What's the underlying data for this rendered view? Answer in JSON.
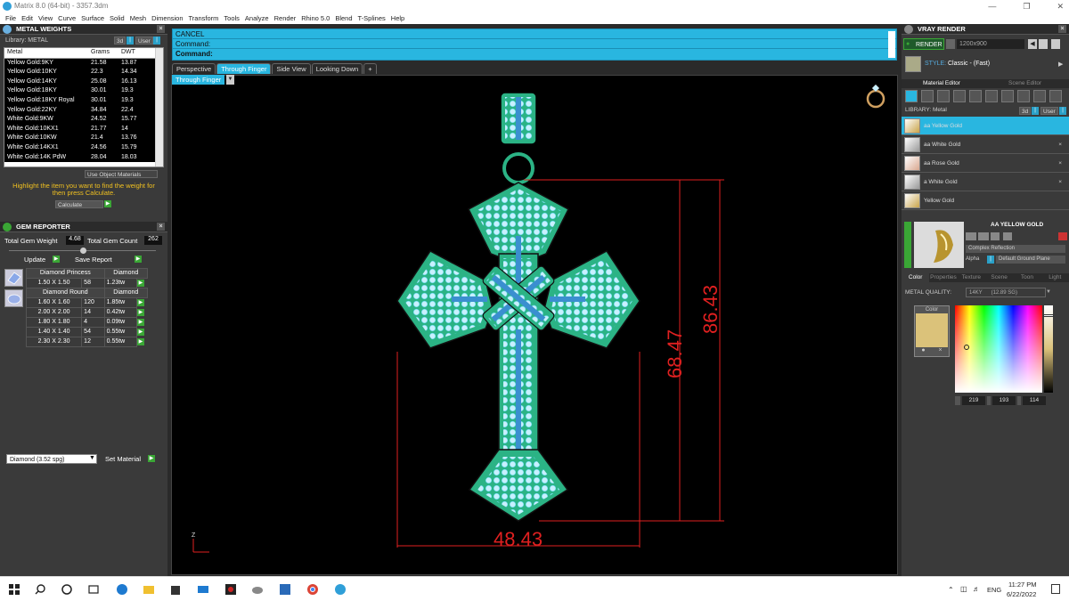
{
  "window": {
    "title": "Matrix 8.0 (64-bit) - 3357.3dm"
  },
  "menu": [
    "File",
    "Edit",
    "View",
    "Curve",
    "Surface",
    "Solid",
    "Mesh",
    "Dimension",
    "Transform",
    "Tools",
    "Analyze",
    "Render",
    "Rhino 5.0",
    "Blend",
    "T-Splines",
    "Help"
  ],
  "metal_weights": {
    "title": "METAL WEIGHTS",
    "library_label": "Library: METAL",
    "lib_btn_3d": "3d",
    "lib_btn_user": "User",
    "columns": [
      "Metal",
      "Grams",
      "DWT"
    ],
    "rows": [
      [
        "Yellow Gold:9KY",
        "21.58",
        "13.87"
      ],
      [
        "Yellow Gold:10KY",
        "22.3",
        "14.34"
      ],
      [
        "Yellow Gold:14KY",
        "25.08",
        "16.13"
      ],
      [
        "Yellow Gold:18KY",
        "30.01",
        "19.3"
      ],
      [
        "Yellow Gold:18KY Royal",
        "30.01",
        "19.3"
      ],
      [
        "Yellow Gold:22KY",
        "34.84",
        "22.4"
      ],
      [
        "White Gold:9KW",
        "24.52",
        "15.77"
      ],
      [
        "White Gold:10KX1",
        "21.77",
        "14"
      ],
      [
        "White Gold:10KW",
        "21.4",
        "13.76"
      ],
      [
        "White Gold:14KX1",
        "24.56",
        "15.79"
      ],
      [
        "White Gold:14K PdW",
        "28.04",
        "18.03"
      ]
    ],
    "use_object_materials": "Use Object Materials",
    "hint": "Highlight the item you want to find the weight for then press Calculate.",
    "calculate": "Calculate"
  },
  "gem_reporter": {
    "title": "GEM REPORTER",
    "total_weight_label": "Total Gem Weight",
    "total_weight": "4.68",
    "total_count_label": "Total Gem Count",
    "total_count": "262",
    "update": "Update",
    "save_report": "Save Report",
    "groups": [
      {
        "shape": "Diamond Princess",
        "material": "Diamond",
        "rows": [
          [
            "1.50 X 1.50",
            "58",
            "1.23tw"
          ]
        ]
      },
      {
        "shape": "Diamond Round",
        "material": "Diamond",
        "rows": [
          [
            "1.60 X 1.60",
            "120",
            "1.85tw"
          ],
          [
            "2.00 X 2.00",
            "14",
            "0.42tw"
          ],
          [
            "1.80 X 1.80",
            "4",
            "0.09tw"
          ],
          [
            "1.40 X 1.40",
            "54",
            "0.55tw"
          ],
          [
            "2.30 X 2.30",
            "12",
            "0.55tw"
          ]
        ]
      }
    ],
    "material_select": "Diamond     (3.52 spg)",
    "set_material": "Set Material"
  },
  "command": {
    "line1": "CANCEL",
    "line2": "Command:",
    "line3": "Command:"
  },
  "view_tabs": [
    "Perspective",
    "Through Finger",
    "Side View",
    "Looking Down",
    "+"
  ],
  "active_tab_index": 1,
  "viewport_label": "Through Finger",
  "dimensions": {
    "width": "48.43",
    "height1": "68.47",
    "height2": "86.43"
  },
  "axis_label": "Z",
  "vray": {
    "title": "VRAY RENDER",
    "render_btn": "RENDER",
    "resolution": "1200x900",
    "style_label": "STYLE:",
    "style_value": "Classic - (Fast)",
    "tabs": [
      "Material Editor",
      "Scene Editor"
    ],
    "library_label": "LIBRARY: Metal",
    "lib_btn_3d": "3d",
    "lib_btn_user": "User",
    "materials": [
      "aa Yellow Gold",
      "aa White Gold",
      "aa Rose Gold",
      "a White Gold",
      "Yellow Gold"
    ],
    "preview_name": "AA YELLOW GOLD",
    "reflection": "Complex Reflection",
    "alpha": "Alpha",
    "ground": "Default Ground Plane",
    "sub_tabs": [
      "Color",
      "Properties",
      "Texture",
      "Scene",
      "Toon",
      "Light"
    ],
    "metal_quality_label": "METAL QUALITY:",
    "metal_quality_value": "14KY",
    "metal_quality_extra": "(12.89 SG)",
    "color_label": "Color",
    "swatch_color": "#dbc27a",
    "rgb": [
      "219",
      "193",
      "114"
    ]
  },
  "taskbar": {
    "time": "11:27 PM",
    "date": "6/22/2022",
    "lang": "ENG"
  }
}
